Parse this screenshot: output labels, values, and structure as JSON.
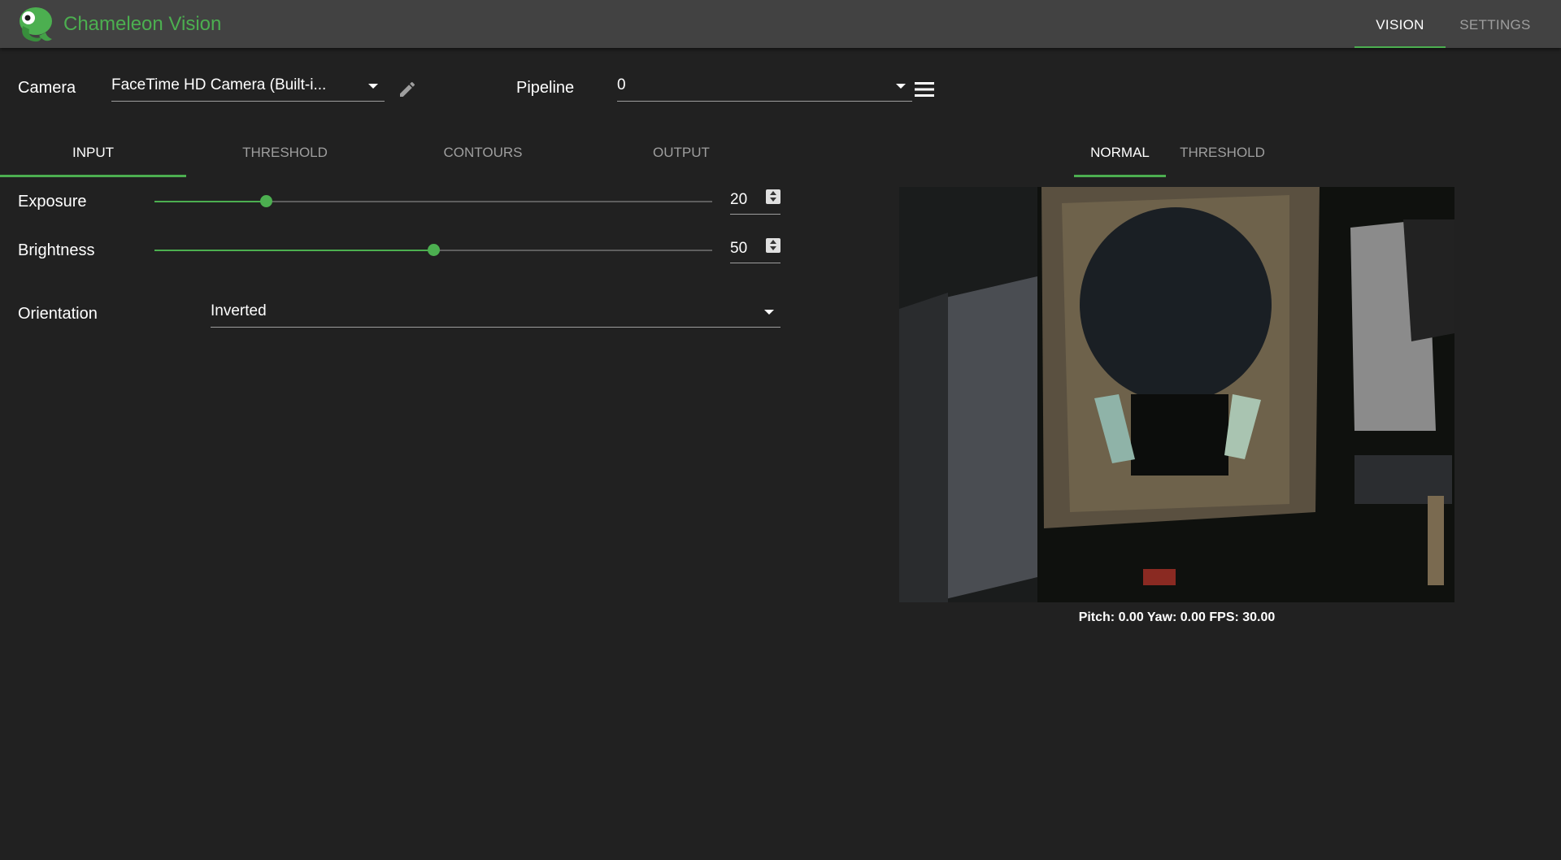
{
  "app": {
    "title": "Chameleon Vision"
  },
  "nav": {
    "tabs": [
      {
        "label": "VISION",
        "active": true
      },
      {
        "label": "SETTINGS",
        "active": false
      }
    ]
  },
  "camera": {
    "label": "Camera",
    "value": "FaceTime HD Camera (Built-i...",
    "edit_icon": "pencil-icon"
  },
  "pipeline": {
    "label": "Pipeline",
    "value": "0",
    "menu_icon": "menu-icon"
  },
  "settings_tabs": [
    {
      "label": "INPUT",
      "active": true
    },
    {
      "label": "THRESHOLD",
      "active": false
    },
    {
      "label": "CONTOURS",
      "active": false
    },
    {
      "label": "OUTPUT",
      "active": false
    }
  ],
  "input": {
    "exposure": {
      "label": "Exposure",
      "value": "20",
      "level": 0.2
    },
    "brightness": {
      "label": "Brightness",
      "value": "50",
      "level": 0.5
    },
    "orientation": {
      "label": "Orientation",
      "value": "Inverted"
    }
  },
  "view_tabs": [
    {
      "label": "NORMAL",
      "active": true
    },
    {
      "label": "THRESHOLD",
      "active": false
    }
  ],
  "stats": "Pitch: 0.00 Yaw: 0.00 FPS: 30.00",
  "colors": {
    "accent": "#4caf50",
    "appbar": "#424242",
    "background": "#212121"
  }
}
